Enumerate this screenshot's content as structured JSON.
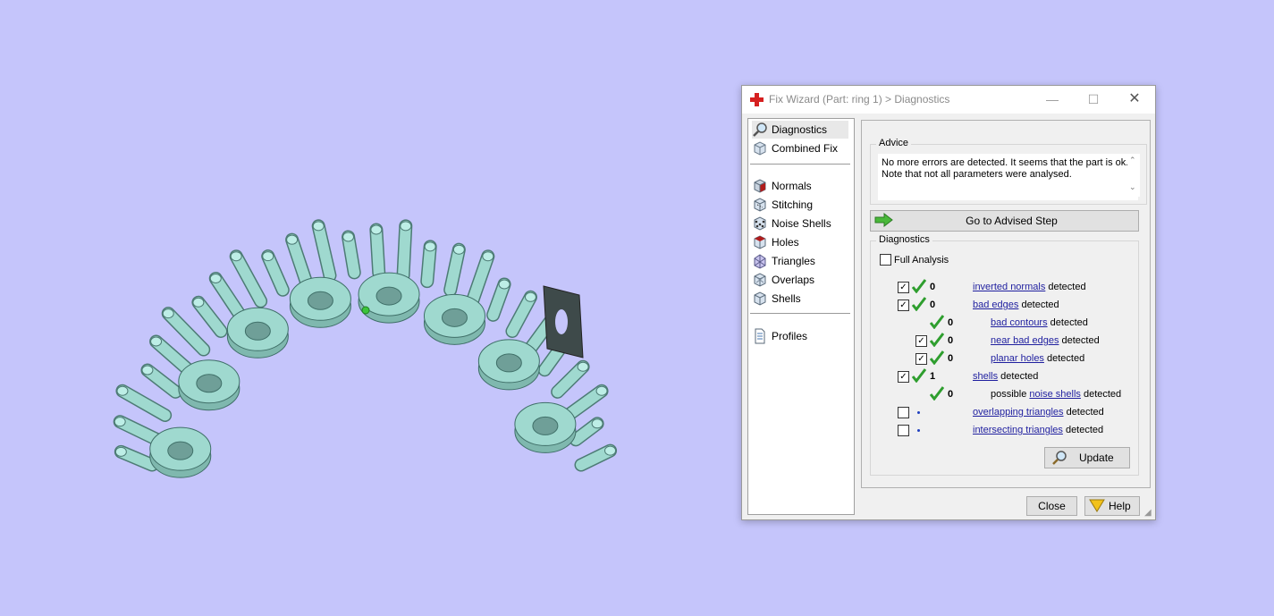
{
  "window": {
    "title": "Fix Wizard (Part: ring 1) > Diagnostics",
    "controls": {
      "minimize": "—",
      "maximize": "☐",
      "close": "✕"
    }
  },
  "nav": {
    "top_items": [
      {
        "label": "Diagnostics",
        "icon": "magnifier-icon",
        "selected": true
      },
      {
        "label": "Combined Fix",
        "icon": "cube-icon",
        "selected": false
      }
    ],
    "fix_items": [
      {
        "label": "Normals",
        "icon": "normals-cube-icon"
      },
      {
        "label": "Stitching",
        "icon": "stitching-cube-icon"
      },
      {
        "label": "Noise Shells",
        "icon": "noise-shells-icon"
      },
      {
        "label": "Holes",
        "icon": "holes-cube-icon"
      },
      {
        "label": "Triangles",
        "icon": "triangles-icon"
      },
      {
        "label": "Overlaps",
        "icon": "overlaps-cube-icon"
      },
      {
        "label": "Shells",
        "icon": "shells-cube-icon"
      }
    ],
    "profiles_label": "Profiles"
  },
  "advice": {
    "group_label": "Advice",
    "text": "No more errors are detected. It seems that the part is ok. Note that not all parameters were analysed.",
    "button_label": "Go to Advised Step"
  },
  "diagnostics": {
    "group_label": "Diagnostics",
    "full_analysis_label": "Full Analysis",
    "full_analysis_checked": false,
    "rows": [
      {
        "checked": true,
        "status": "ok",
        "count": "0",
        "prefix": "",
        "link": "inverted normals",
        "suffix": " detected"
      },
      {
        "checked": true,
        "status": "ok",
        "count": "0",
        "prefix": "",
        "link": "bad edges",
        "suffix": " detected"
      },
      {
        "checked": null,
        "status": "ok",
        "count": "0",
        "prefix": "",
        "link": "bad contours",
        "suffix": " detected"
      },
      {
        "checked": true,
        "status": "ok",
        "count": "0",
        "prefix": "",
        "link": "near bad edges",
        "suffix": " detected"
      },
      {
        "checked": true,
        "status": "ok",
        "count": "0",
        "prefix": "",
        "link": "planar holes",
        "suffix": " detected"
      },
      {
        "checked": true,
        "status": "ok",
        "count": "1",
        "prefix": "",
        "link": "shells",
        "suffix": " detected"
      },
      {
        "checked": null,
        "status": "ok",
        "count": "0",
        "prefix": "possible ",
        "link": "noise shells",
        "suffix": " detected"
      },
      {
        "checked": false,
        "status": "pending",
        "count": "",
        "prefix": "",
        "link": "overlapping triangles",
        "suffix": " detected"
      },
      {
        "checked": false,
        "status": "pending",
        "count": "",
        "prefix": "",
        "link": "intersecting triangles",
        "suffix": " detected"
      }
    ],
    "update_label": "Update"
  },
  "footer": {
    "close_label": "Close",
    "help_label": "Help"
  },
  "colors": {
    "viewport_bg": "#c5c5fb",
    "part_fill": "#9fd9cf",
    "check_green": "#2e9e2e",
    "link_blue": "#1f1f9f"
  }
}
